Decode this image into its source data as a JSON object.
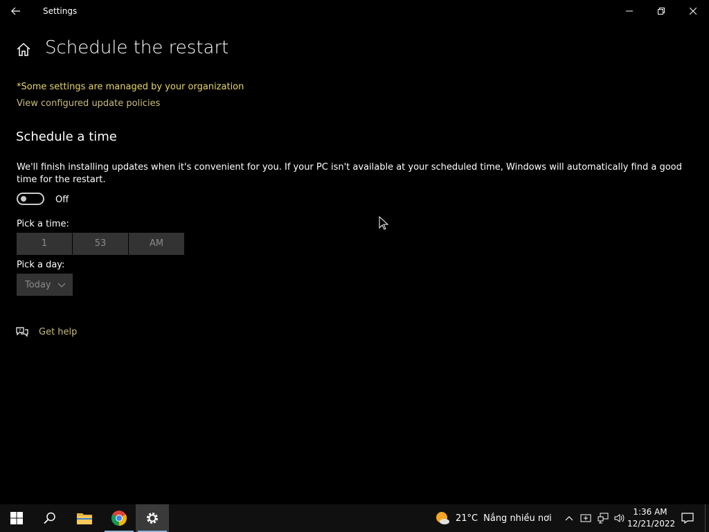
{
  "window": {
    "title": "Settings"
  },
  "page": {
    "title": "Schedule the restart",
    "managed_notice": "*Some settings are managed by your organization",
    "policies_link": "View configured update policies",
    "section_title": "Schedule a time",
    "description": "We'll finish installing updates when it's convenient for you. If your PC isn't available at your scheduled time, Windows will automatically find a good time for the restart.",
    "toggle": {
      "state": "Off",
      "on": false
    },
    "pick_time_label": "Pick a time:",
    "time": {
      "hour": "1",
      "minute": "53",
      "period": "AM"
    },
    "pick_day_label": "Pick a day:",
    "day": {
      "selected": "Today"
    },
    "help_link": "Get help"
  },
  "taskbar": {
    "weather": {
      "temp": "21°C",
      "condition": "Nắng nhiều nơi"
    },
    "clock": {
      "time": "1:36 AM",
      "date": "12/21/2022"
    },
    "icons": [
      "windows-start-icon",
      "search-icon",
      "file-explorer-icon",
      "chrome-icon",
      "settings-gear-icon"
    ]
  },
  "colors": {
    "background": "#000000",
    "managed_text": "#e8d56b",
    "link": "#c9bd7a",
    "control_bg": "#333333",
    "taskbar_bg": "#101010"
  }
}
